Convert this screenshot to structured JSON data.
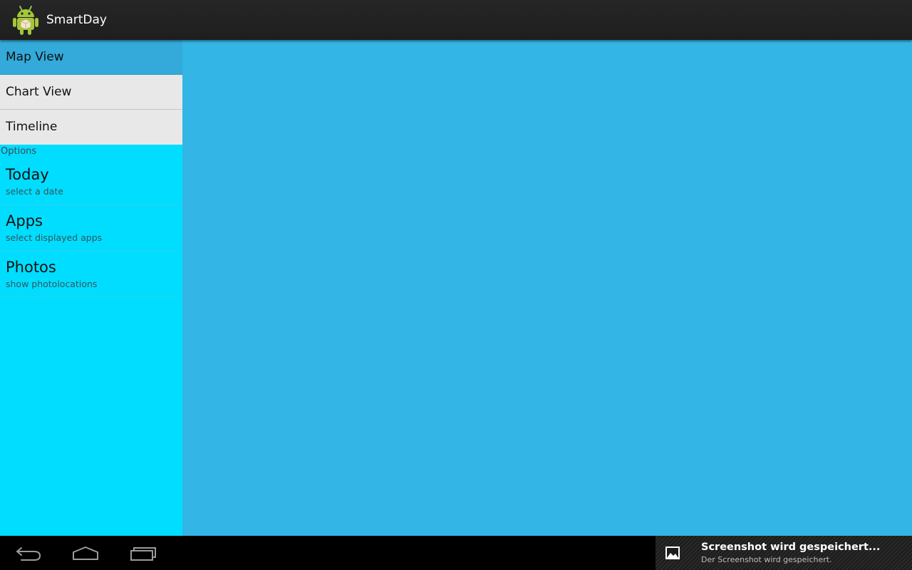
{
  "app": {
    "title": "SmartDay",
    "icon": "android-robot-icon"
  },
  "sidebar": {
    "nav_items": [
      {
        "label": "Map View",
        "selected": true
      },
      {
        "label": "Chart View",
        "selected": false
      },
      {
        "label": "Timeline",
        "selected": false
      }
    ],
    "options_header": "Options",
    "options": [
      {
        "title": "Today",
        "summary": "select a date"
      },
      {
        "title": "Apps",
        "summary": "select displayed apps"
      },
      {
        "title": "Photos",
        "summary": "show photolocations"
      }
    ]
  },
  "system_bar": {
    "buttons": [
      "back-icon",
      "home-icon",
      "recent-apps-icon"
    ],
    "notification": {
      "icon": "image-icon",
      "title": "Screenshot wird gespeichert...",
      "text": "Der Screenshot wird gespeichert."
    }
  },
  "colors": {
    "action_bar": "#222222",
    "nav_selected": "#33aada",
    "nav_item": "#e8e8e8",
    "sidebar": "#00ddff",
    "content": "#33b5e5",
    "system_bar": "#000000"
  }
}
